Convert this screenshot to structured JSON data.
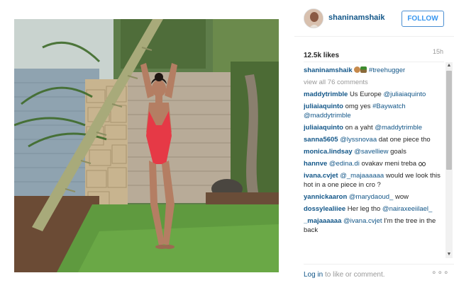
{
  "post": {
    "image_alt": "",
    "username": "shaninamshaik",
    "follow_label": "FOLLOW",
    "likes": "12.5k likes",
    "time": "15h"
  },
  "caption": {
    "author": "shaninamshaik",
    "text": "#treehugger",
    "emojis": [
      "monkey-emoji",
      "palm-tree-emoji"
    ]
  },
  "view_all": "view all 76 comments",
  "comments": [
    {
      "author": "maddytrimble",
      "text": "Us Europe",
      "mention": "@juliaiaquinto",
      "after": ""
    },
    {
      "author": "juliaiaquinto",
      "text": "omg yes",
      "mention": "#Baywatch",
      "after": "",
      "mention2": "@maddytrimble"
    },
    {
      "author": "juliaiaquinto",
      "text": "on a yaht",
      "mention": "@maddytrimble",
      "after": ""
    },
    {
      "author": "sanna5605",
      "text": "",
      "mention": "@lyssnovaa",
      "after": "dat one piece tho"
    },
    {
      "author": "monica.lindsay",
      "text": "",
      "mention": "@savelliew",
      "after": "goals"
    },
    {
      "author": "hannve",
      "text": "",
      "mention": "@edina.di",
      "after": "ovakav meni treba"
    },
    {
      "author": "ivana.cvjet",
      "text": "",
      "mention": "@_majaaaaaa",
      "after": "would we look this hot in a one piece in cro ?"
    },
    {
      "author": "yannickaaron",
      "text": "",
      "mention": "@marydaoud_",
      "after": "wow"
    },
    {
      "author": "dossylealiiee",
      "text": "Her leg tho",
      "mention": "@nairaxeeiilael_",
      "after": ""
    },
    {
      "author": "_majaaaaaa",
      "text": "",
      "mention": "@ivana.cvjet",
      "after": "I'm the tree in the back"
    }
  ],
  "footer": {
    "login_link": "Log in",
    "login_text": "to like or comment.",
    "more": "∘∘∘"
  },
  "colors": {
    "link": "#125688",
    "follow": "#3897f0",
    "muted": "#999999",
    "swimsuit": "#e63946"
  }
}
